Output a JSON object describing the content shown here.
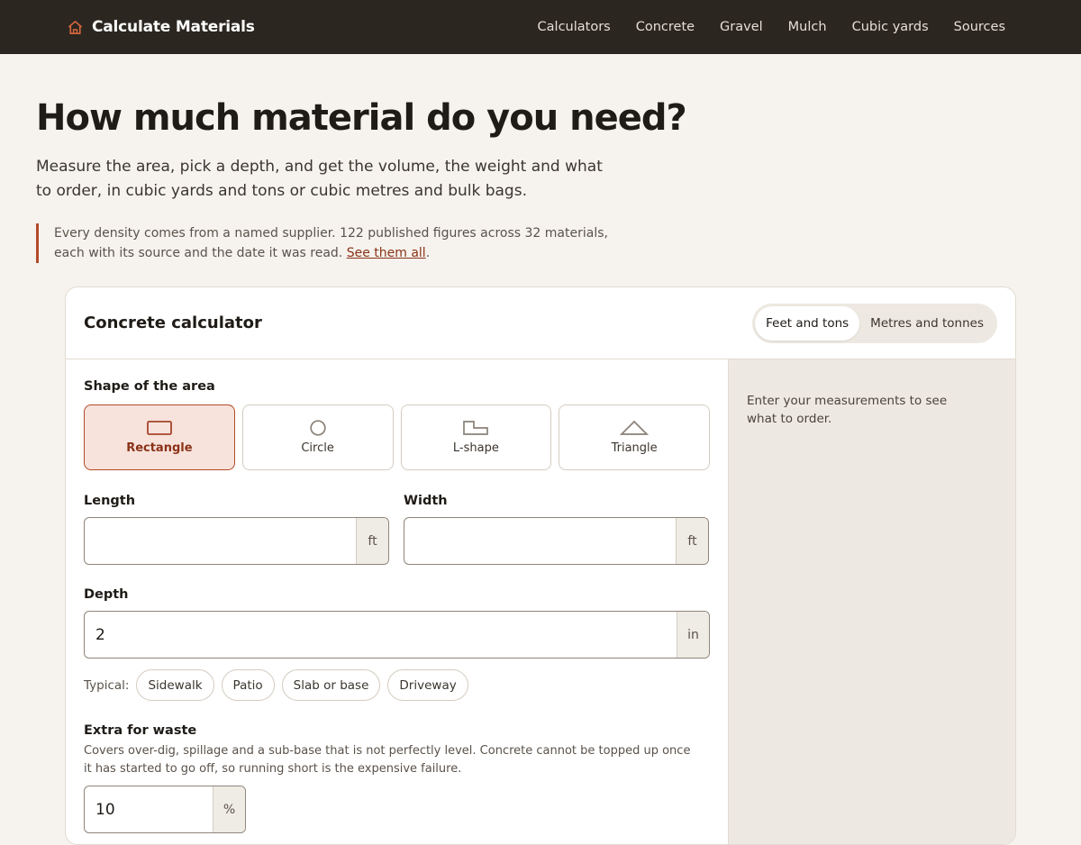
{
  "header": {
    "brand": "Calculate Materials",
    "logo_icon": "house-icon",
    "nav": [
      "Calculators",
      "Concrete",
      "Gravel",
      "Mulch",
      "Cubic yards",
      "Sources"
    ]
  },
  "hero": {
    "title": "How much material do you need?",
    "lede": "Measure the area, pick a depth, and get the volume, the weight and what to order, in cubic yards and tons or cubic metres and bulk bags.",
    "note_text": "Every density comes from a named supplier. 122 published figures across 32 materials, each with its source and the date it was read. ",
    "note_link": "See them all",
    "note_end": "."
  },
  "calculator": {
    "title": "Concrete calculator",
    "units": [
      "Feet and tons",
      "Metres and tonnes"
    ],
    "selected_unit": "Feet and tons",
    "shape_label": "Shape of the area",
    "shapes": [
      "Rectangle",
      "Circle",
      "L-shape",
      "Triangle"
    ],
    "selected_shape": "Rectangle",
    "length": {
      "label": "Length",
      "value": "",
      "unit": "ft"
    },
    "width": {
      "label": "Width",
      "value": "",
      "unit": "ft"
    },
    "depth": {
      "label": "Depth",
      "value": "2",
      "unit": "in"
    },
    "typical_label": "Typical:",
    "typical_chips": [
      "Sidewalk",
      "Patio",
      "Slab or base",
      "Driveway"
    ],
    "waste": {
      "label": "Extra for waste",
      "help": "Covers over-dig, spillage and a sub-base that is not perfectly level. Concrete cannot be topped up once it has started to go off, so running short is the expensive failure.",
      "value": "10",
      "unit": "%"
    },
    "result_placeholder": "Enter your measurements to see what to order."
  },
  "colors": {
    "header_bg": "#2b2620",
    "accent": "#b24a2a",
    "page_bg": "#f6f3ee"
  }
}
